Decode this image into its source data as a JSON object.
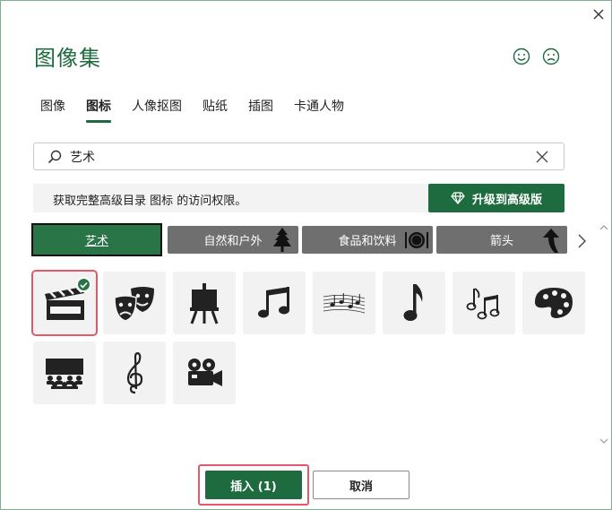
{
  "window": {
    "title": "图像集",
    "close_icon": "close-icon",
    "feedback_positive_icon": "smile-icon",
    "feedback_negative_icon": "frown-icon"
  },
  "tabs": [
    {
      "label": "图像",
      "active": false
    },
    {
      "label": "图标",
      "active": true
    },
    {
      "label": "人像抠图",
      "active": false
    },
    {
      "label": "贴纸",
      "active": false
    },
    {
      "label": "插图",
      "active": false
    },
    {
      "label": "卡通人物",
      "active": false
    }
  ],
  "search": {
    "value": "艺术",
    "placeholder": "",
    "icon": "search-icon",
    "clear_icon": "clear-icon"
  },
  "banner": {
    "text": "获取完整高级目录 图标 的访问权限。",
    "upgrade_label": "升级到高级版",
    "upgrade_icon": "diamond-icon"
  },
  "categories": [
    {
      "label": "艺术",
      "active": true,
      "icon": ""
    },
    {
      "label": "自然和户外",
      "active": false,
      "icon": "tree-icon"
    },
    {
      "label": "食品和饮料",
      "active": false,
      "icon": "plate-icon"
    },
    {
      "label": "箭头",
      "active": false,
      "icon": "arrow-icon"
    }
  ],
  "icons": [
    {
      "name": "clapperboard-icon",
      "selected": true
    },
    {
      "name": "theater-masks-icon",
      "selected": false
    },
    {
      "name": "easel-icon",
      "selected": false
    },
    {
      "name": "music-notes-icon",
      "selected": false
    },
    {
      "name": "sheet-music-icon",
      "selected": false
    },
    {
      "name": "eighth-note-icon",
      "selected": false
    },
    {
      "name": "music-notes-outline-icon",
      "selected": false
    },
    {
      "name": "palette-icon",
      "selected": false
    },
    {
      "name": "cinema-audience-icon",
      "selected": false
    },
    {
      "name": "treble-clef-icon",
      "selected": false
    },
    {
      "name": "movie-camera-icon",
      "selected": false
    }
  ],
  "footer": {
    "insert_label": "插入 (1)",
    "cancel_label": "取消"
  },
  "colors": {
    "accent": "#1e6b3f",
    "category_inactive": "#6f6f6f",
    "highlight": "#e05a6a"
  }
}
